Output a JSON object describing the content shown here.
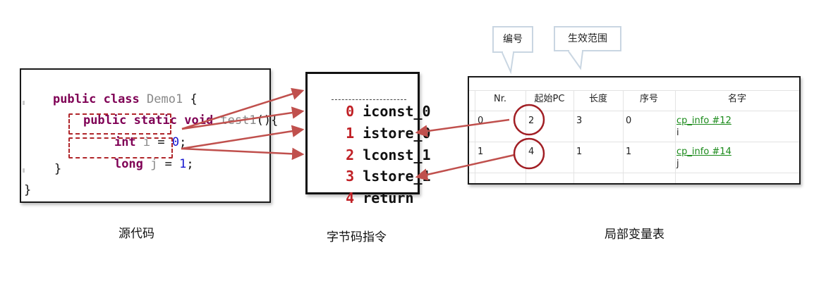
{
  "source_code": {
    "lines": [
      {
        "t1": "public class ",
        "t2": "Demo1",
        "t3": " {"
      },
      {
        "t1": "public static void ",
        "t2": "test1",
        "t3": "(){"
      },
      {
        "t1": "int",
        "t2": " i",
        "t3": " = ",
        "t4": "0",
        "t5": ";"
      },
      {
        "t1": "long",
        "t2": " j",
        "t3": " = ",
        "t4": "1",
        "t5": ";"
      },
      {
        "t1": "}"
      },
      {
        "t1": "}"
      }
    ],
    "caption": "源代码"
  },
  "bytecode": {
    "instructions": [
      {
        "index": "0",
        "op": "iconst_0"
      },
      {
        "index": "1",
        "op": "istore_0"
      },
      {
        "index": "2",
        "op": "lconst_1"
      },
      {
        "index": "3",
        "op": "lstore_1"
      },
      {
        "index": "4",
        "op": "return"
      }
    ],
    "caption": "字节码指令"
  },
  "local_variable_table": {
    "headers": [
      "Nr.",
      "起始PC",
      "长度",
      "序号",
      "名字"
    ],
    "rows": [
      {
        "nr": "0",
        "start_pc": "2",
        "length": "3",
        "index": "0",
        "name_link": "cp_info #12",
        "name": "i"
      },
      {
        "nr": "1",
        "start_pc": "4",
        "length": "1",
        "index": "1",
        "name_link": "cp_info #14",
        "name": "j"
      }
    ],
    "caption": "局部变量表"
  },
  "callouts": {
    "number": "编号",
    "scope": "生效范围"
  },
  "colors": {
    "annotation_red": "#c0504d",
    "keyword": "#7f0055",
    "number": "#1515d0",
    "link_green": "#1a8a1a"
  }
}
